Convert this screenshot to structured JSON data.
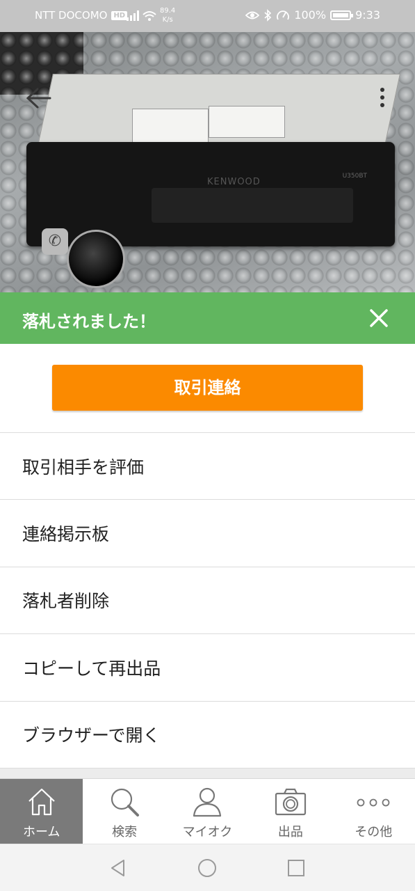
{
  "status_bar": {
    "carrier": "NTT DOCOMO",
    "hd_badge": "HD",
    "network_speed_value": "89.4",
    "network_speed_unit": "K/s",
    "battery_text": "100%",
    "time": "9:33"
  },
  "photo": {
    "brand_text": "KENWOOD",
    "model_text": "U350BT"
  },
  "banner": {
    "text": "落札されました！"
  },
  "main_action": {
    "label": "取引連絡"
  },
  "menu": {
    "items": [
      {
        "label": "取引相手を評価"
      },
      {
        "label": "連絡掲示板"
      },
      {
        "label": "落札者削除"
      },
      {
        "label": "コピーして再出品"
      },
      {
        "label": "ブラウザーで開く"
      }
    ]
  },
  "bottom_nav": {
    "items": [
      {
        "label": "ホーム",
        "icon": "home-icon",
        "active": true
      },
      {
        "label": "検索",
        "icon": "search-icon",
        "active": false
      },
      {
        "label": "マイオク",
        "icon": "person-icon",
        "active": false
      },
      {
        "label": "出品",
        "icon": "camera-icon",
        "active": false
      },
      {
        "label": "その他",
        "icon": "more-dots-icon",
        "active": false
      }
    ]
  },
  "colors": {
    "banner_green": "#61b65f",
    "accent_orange": "#fb8a00",
    "active_nav_gray": "#7a7a7a",
    "status_bar_gray": "#c4c4c4"
  }
}
